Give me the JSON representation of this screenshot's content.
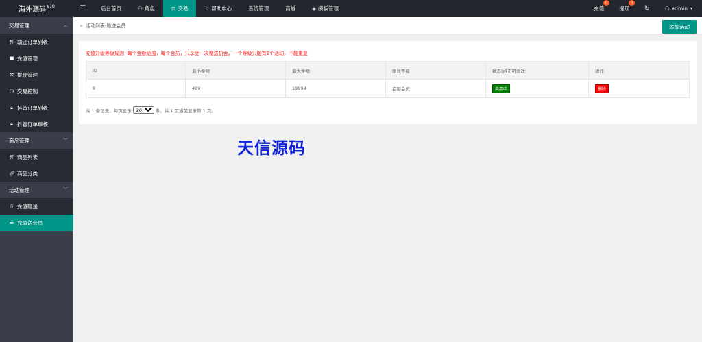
{
  "app": {
    "title": "海外源码",
    "version": "V10"
  },
  "topnav": [
    {
      "label": "后台首页",
      "icon": "",
      "active": false
    },
    {
      "label": "角色",
      "icon": "user-icon",
      "active": false
    },
    {
      "label": "交易",
      "icon": "balance-scale-icon",
      "active": true
    },
    {
      "label": "帮助中心",
      "icon": "flag-icon",
      "active": false
    },
    {
      "label": "系统管理",
      "icon": "",
      "active": false
    },
    {
      "label": "商城",
      "icon": "",
      "active": false
    },
    {
      "label": "模板管理",
      "icon": "layers-icon",
      "active": false
    }
  ],
  "rightnav": {
    "recharge": {
      "label": "充值",
      "badge": "0"
    },
    "withdraw": {
      "label": "提现",
      "badge": "0"
    },
    "user": "admin"
  },
  "sidebar": {
    "group1": "交易管理",
    "group1_items": [
      {
        "label": "助还订单列表",
        "icon": "cart-icon"
      },
      {
        "label": "充值管理",
        "icon": "comment-icon"
      },
      {
        "label": "提现管理",
        "icon": "gavel-icon"
      },
      {
        "label": "交易控制",
        "icon": "dashboard-icon"
      },
      {
        "label": "抖音订单列表",
        "icon": "lock-icon"
      },
      {
        "label": "抖音订单审核",
        "icon": "lock-icon"
      }
    ],
    "group2": "商品管理",
    "group2_items": [
      {
        "label": "商品列表",
        "icon": "cart-icon"
      },
      {
        "label": "商品分类",
        "icon": "link-icon"
      }
    ],
    "group3": "活动管理",
    "group3_items": [
      {
        "label": "充值赠送",
        "icon": "mobile-icon"
      },
      {
        "label": "充值送会员",
        "icon": "list-icon"
      }
    ]
  },
  "breadcrumb": "活动列表-赠送会员",
  "add_button": "添加活动",
  "notice": "充值升级等级规则: 每个金额范围，每个会员，只享受一次赠送机会。一个等级只能有1个活动，不能重复",
  "table": {
    "headers": [
      "ID",
      "最小金额",
      "最大金额",
      "赠送等级",
      "状态(点击可修改)",
      "操作"
    ],
    "rows": [
      {
        "id": "8",
        "min": "499",
        "max": "19998",
        "level": "白银会员",
        "status": "启用中",
        "action": "删除"
      }
    ]
  },
  "pager": {
    "prefix": "共 1 条记录。每页显示",
    "page_size": "20",
    "suffix": "条。共 1 页当前显示第 1 页。"
  },
  "watermark": "天信源码",
  "colors": {
    "accent": "#009688",
    "topbar": "#23262e",
    "sidebar": "#393d49",
    "danger": "#ff0000",
    "success": "#008000"
  }
}
